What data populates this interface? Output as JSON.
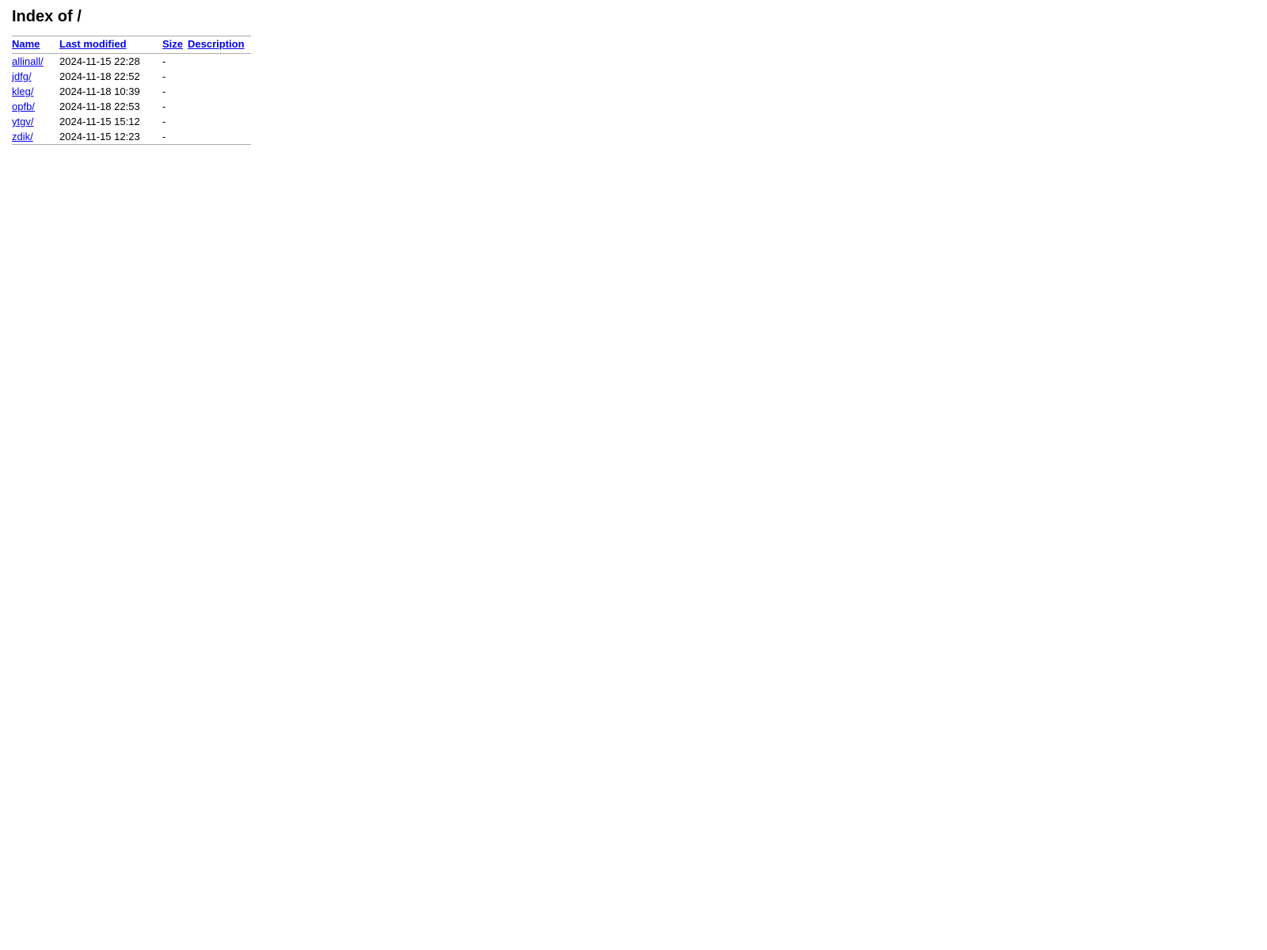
{
  "page": {
    "title": "Index of /"
  },
  "table": {
    "columns": {
      "name": "Name",
      "last_modified": "Last modified",
      "size": "Size",
      "description": "Description"
    },
    "rows": [
      {
        "name": "allinall/",
        "href": "allinall/",
        "last_modified": "2024-11-15 22:28",
        "size": "-",
        "description": ""
      },
      {
        "name": "jdfg/",
        "href": "jdfg/",
        "last_modified": "2024-11-18 22:52",
        "size": "-",
        "description": ""
      },
      {
        "name": "kleg/",
        "href": "kleg/",
        "last_modified": "2024-11-18 10:39",
        "size": "-",
        "description": ""
      },
      {
        "name": "opfb/",
        "href": "opfb/",
        "last_modified": "2024-11-18 22:53",
        "size": "-",
        "description": ""
      },
      {
        "name": "ytgv/",
        "href": "ytgv/",
        "last_modified": "2024-11-15 15:12",
        "size": "-",
        "description": ""
      },
      {
        "name": "zdik/",
        "href": "zdik/",
        "last_modified": "2024-11-15 12:23",
        "size": "-",
        "description": ""
      }
    ]
  }
}
